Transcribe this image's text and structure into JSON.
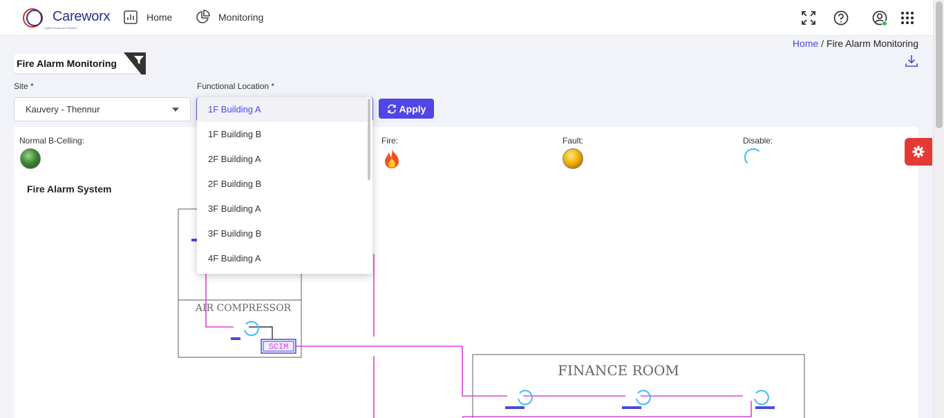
{
  "brand": {
    "name": "Careworx",
    "tagline": "Digital Healthcare Platform"
  },
  "nav": {
    "home": "Home",
    "monitoring": "Monitoring"
  },
  "header_icons": [
    "fullscreen-icon",
    "help-icon",
    "user-icon",
    "apps-grid-icon"
  ],
  "breadcrumb": {
    "home": "Home",
    "separator": "/",
    "current": "Fire Alarm Monitoring"
  },
  "page": {
    "title": "Fire Alarm Monitoring"
  },
  "filters": {
    "site_label": "Site *",
    "site_value": "Kauvery - Thennur",
    "location_label": "Functional Location *",
    "apply_label": "Apply"
  },
  "location_options": [
    "1F Building A",
    "1F Building B",
    "2F Building A",
    "2F Building B",
    "3F Building A",
    "3F Building B",
    "4F Building A"
  ],
  "location_selected": "1F Building A",
  "legend": {
    "normal": "Normal B-Celling:",
    "fire": "Fire:",
    "fault": "Fault:",
    "disable": "Disable:"
  },
  "system": {
    "title": "Fire Alarm System"
  },
  "floorplan": {
    "air_compressor": "AIR COMPRESSOR",
    "finance_room": "FINANCE ROOM",
    "scim": "SCIM"
  },
  "colors": {
    "accent": "#4f46e5",
    "wire": "#e040e0",
    "detector": "#38bdf8",
    "settings": "#e53935",
    "online": "#22c55e"
  }
}
